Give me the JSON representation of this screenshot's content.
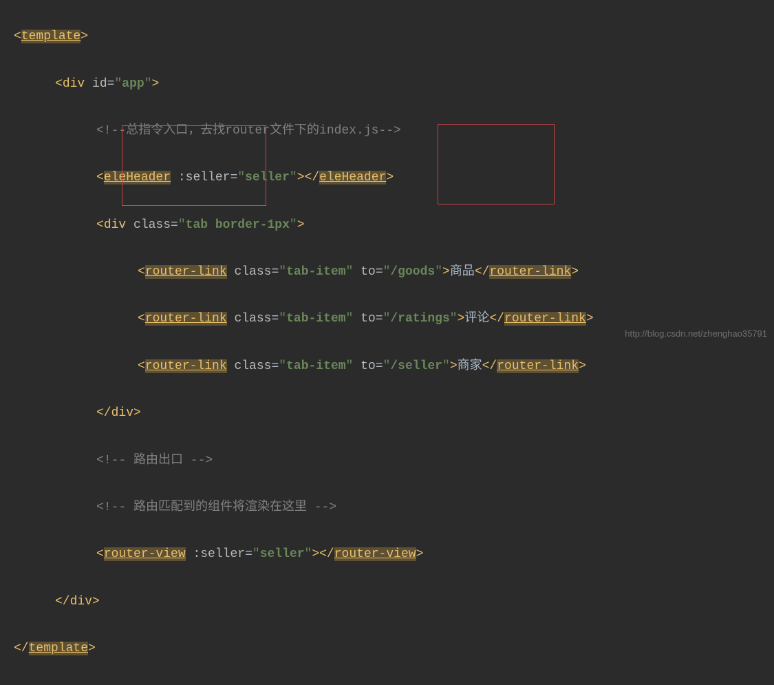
{
  "lines": {
    "l1": {
      "open": "<",
      "tag": "template",
      "close": ">"
    },
    "l2": {
      "open": "<",
      "tag": "div",
      "attr": "id",
      "eq": "=",
      "q": "\"",
      "val": "app",
      "close": ">"
    },
    "l3": {
      "comment": "<!--总指令入口，去找router文件下的index.js-->"
    },
    "l4": {
      "open": "<",
      "tag": "eleHeader",
      "sp": " ",
      "attr": ":seller",
      "eq": "=",
      "q": "\"",
      "val": "seller",
      "mid": "></",
      "closetag": "eleHeader",
      "close": ">"
    },
    "l5": {
      "open": "<",
      "tag": "div",
      "sp": " ",
      "attr": "class",
      "eq": "=",
      "q": "\"",
      "val": "tab border-1px",
      "close": ">"
    },
    "l6": {
      "open": "<",
      "tag": "router-link",
      "sp": " ",
      "attr1": "class",
      "eq": "=",
      "q": "\"",
      "val1": "tab-item",
      "attr2": "to",
      "val2": "/goods",
      "text": "商品",
      "closeopen": "</",
      "closetag": "router-link",
      "close": ">"
    },
    "l7": {
      "open": "<",
      "tag": "router-link",
      "sp": " ",
      "attr1": "class",
      "eq": "=",
      "q": "\"",
      "val1": "tab-item",
      "attr2": "to",
      "val2": "/ratings",
      "text": "评论",
      "closeopen": "</",
      "closetag": "router-link",
      "close": ">"
    },
    "l8": {
      "open": "<",
      "tag": "router-link",
      "sp": " ",
      "attr1": "class",
      "eq": "=",
      "q": "\"",
      "val1": "tab-item",
      "attr2": "to",
      "val2": "/seller",
      "text": "商家",
      "closeopen": "</",
      "closetag": "router-link",
      "close": ">"
    },
    "l9": {
      "open": "</",
      "tag": "div",
      "close": ">"
    },
    "l10": {
      "comment": "<!-- 路由出口 -->"
    },
    "l11": {
      "comment": "<!-- 路由匹配到的组件将渲染在这里 -->"
    },
    "l12": {
      "open": "<",
      "tag": "router-view",
      "sp": " ",
      "attr": ":seller",
      "eq": "=",
      "q": "\"",
      "val": "seller",
      "mid": "></",
      "closetag": "router-view",
      "close": ">"
    },
    "l13": {
      "open": "</",
      "tag": "div",
      "close": ">"
    },
    "l14": {
      "open": "</",
      "tag": "template",
      "close": ">"
    }
  },
  "watermark": "http://blog.csdn.net/zhenghao35791"
}
